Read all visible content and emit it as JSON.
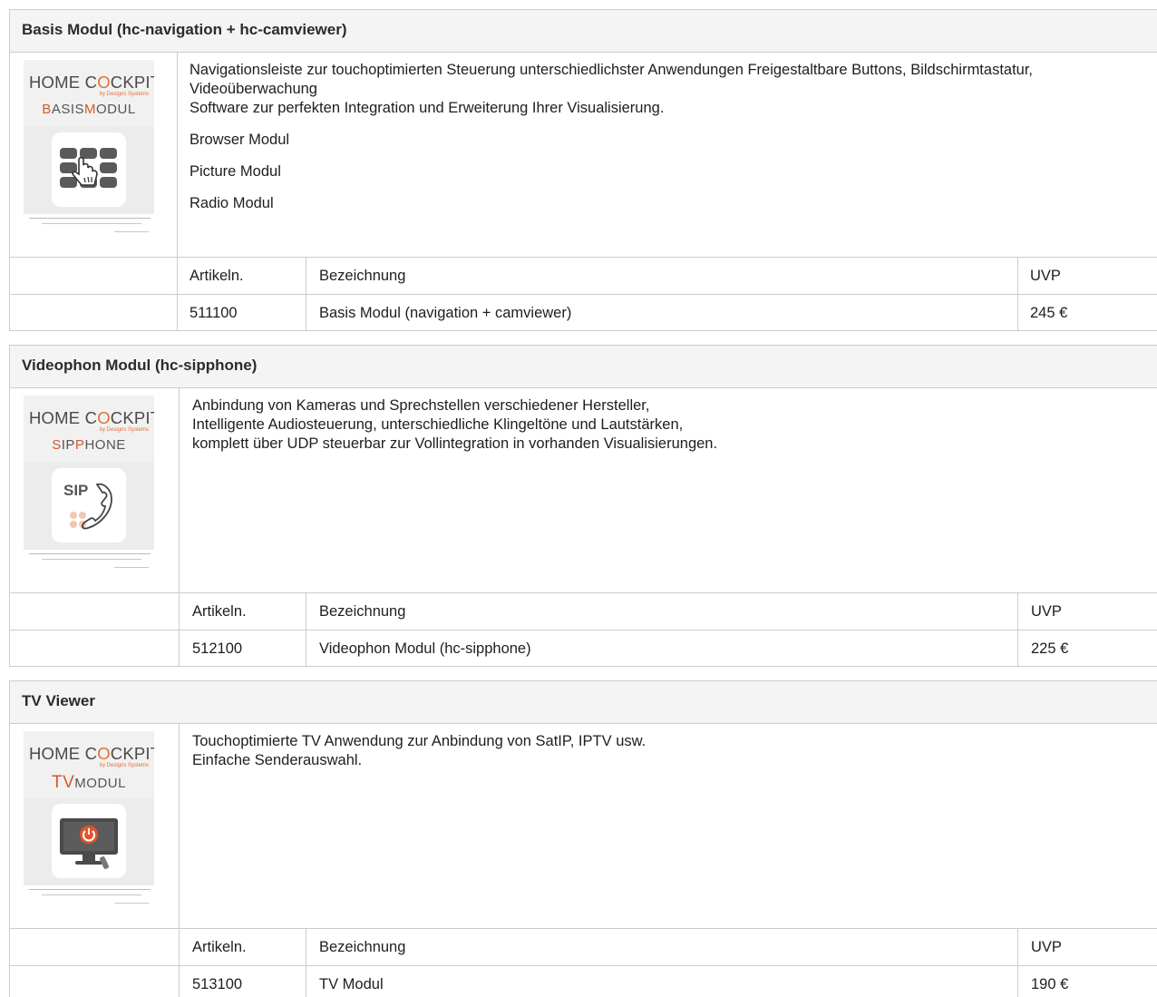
{
  "modules": [
    {
      "title": "Basis Modul (hc-navigation + hc-camviewer)",
      "logo": {
        "brand": "HOME COCKPIT",
        "brand_o": "O",
        "by": "by Designs Systems",
        "module_name": "BasisModul",
        "icon": "keypad-hand-icon"
      },
      "description": [
        "Navigationsleiste zur touchoptimierten Steuerung unterschiedlichster Anwendungen Freigestaltbare Buttons, Bildschirmtastatur,",
        "Videoüberwachung",
        "Software zur perfekten Integration und Erweiterung Ihrer Visualisierung."
      ],
      "extras": [
        "Browser Modul",
        "Picture Modul",
        "Radio Modul"
      ],
      "table": {
        "col_article": "Artikeln.",
        "col_name": "Bezeichnung",
        "col_price": "UVP",
        "article": "511100",
        "name": "Basis Modul (navigation + camviewer)",
        "price": "245 €"
      }
    },
    {
      "title": "Videophon Modul (hc-sipphone)",
      "logo": {
        "brand": "HOME COCKPIT",
        "brand_o": "O",
        "by": "by Designs Systems",
        "module_name": "SipPhone",
        "icon": "sip-phone-icon"
      },
      "description": [
        "Anbindung von Kameras und Sprechstellen verschiedener Hersteller,",
        "Intelligente Audiosteuerung, unterschiedliche Klingeltöne und Lautstärken,",
        "komplett über UDP steuerbar zur Vollintegration in vorhanden Visualisierungen."
      ],
      "extras": [],
      "table": {
        "col_article": "Artikeln.",
        "col_name": "Bezeichnung",
        "col_price": "UVP",
        "article": "512100",
        "name": "Videophon Modul (hc-sipphone)",
        "price": "225 €"
      }
    },
    {
      "title": "TV Viewer",
      "logo": {
        "brand": "HOME COCKPIT",
        "brand_o": "O",
        "by": "by Designs Systems",
        "module_name": "TV Modul",
        "icon": "tv-power-icon"
      },
      "description": [
        "Touchoptimierte TV Anwendung zur Anbindung von SatIP, IPTV usw.",
        "Einfache Senderauswahl."
      ],
      "extras": [],
      "table": {
        "col_article": "Artikeln.",
        "col_name": "Bezeichnung",
        "col_price": "UVP",
        "article": "513100",
        "name": "TV Modul",
        "price": "190 €"
      }
    }
  ]
}
